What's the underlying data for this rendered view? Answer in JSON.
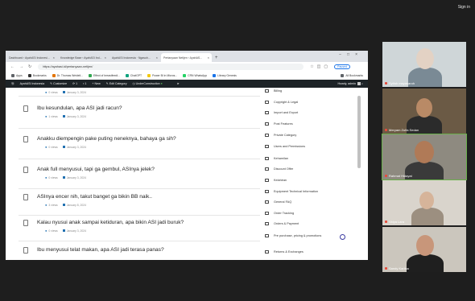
{
  "meeting": {
    "sign_in": "Sign in"
  },
  "browser": {
    "tabs": [
      {
        "label": "Dashboard ‹ AyahASI Indonesi..."
      },
      {
        "label": "Knowledge Base ‹ AyahASI Ind..."
      },
      {
        "label": "AyahASI Indonesia · Ngasuh..."
      },
      {
        "label": "Pertanyaan Netijen ‹ AyahAS..."
      }
    ],
    "url": "https://ayahasi.id/pertanyaan-netijen/",
    "paused_label": "Paused",
    "bookmarks": [
      {
        "label": "Apps",
        "color": "#5f6368"
      },
      {
        "label": "Bookmarks",
        "color": "#333333"
      },
      {
        "label": "Dr. Thomas Weideli...",
        "color": "#e37400"
      },
      {
        "label": "Effect of breastfeedi...",
        "color": "#34a853"
      },
      {
        "label": "ChatGPT",
        "color": "#10a37f"
      },
      {
        "label": "Power BI in Micros...",
        "color": "#f2c811"
      },
      {
        "label": "CRN WhatsApp",
        "color": "#25d366"
      },
      {
        "label": "Library Genesis",
        "color": "#1a73e8"
      }
    ],
    "all_bookmarks": "All Bookmarks"
  },
  "wp_admin": {
    "site": "AyahASI Indonesia",
    "customize": "Customize",
    "updates": "1",
    "comments": "1",
    "new": "+ New",
    "edit_category": "Edit Category",
    "under_construction": "UnderConstruction",
    "howdy": "Howdy, admin"
  },
  "posts": [
    {
      "title": "",
      "views": "0 views",
      "date": "January 3, 2024"
    },
    {
      "title": "Ibu kesundulan, apa ASI jadi racun?",
      "views": "1 views",
      "date": "January 3, 2024"
    },
    {
      "title": "Anakku diempengin pake puting neneknya, bahaya ga sih?",
      "views": "0 views",
      "date": "January 3, 2024"
    },
    {
      "title": "Anak full menyusui, tapi ga gembul, ASInya jelek?",
      "views": "0 views",
      "date": "January 3, 2024"
    },
    {
      "title": "ASInya encer nih, takut banget ga bikin BB naik..",
      "views": "3 views",
      "date": "January 8, 2024"
    },
    {
      "title": "Kalau nyusui anak sampai ketiduran, apa bikin ASI jadi buruk?",
      "views": "0 views",
      "date": "January 3, 2024"
    },
    {
      "title": "Ibu menyusui telat makan, apa ASI jadi terasa panas?",
      "views": "",
      "date": ""
    }
  ],
  "categories": [
    "Billing",
    "Copyright & Legal",
    "Import and Export",
    "Post Features",
    "Private Category",
    "Users and Permissions",
    "Kehamilan",
    "Discount Offer",
    "Kelahiran",
    "Equipment Technical Information",
    "General FAQ",
    "Order Tracking",
    "Orders & Payment",
    "Pre purchase, pricing & promotions",
    "Returns & Exchanges"
  ],
  "participants": [
    {
      "name": "Syifah mayasaroh",
      "bg": "#cfd6d8",
      "skin": "#e3d2c4",
      "top": "#7a8a95"
    },
    {
      "name": "Meryam Zulfa Sedan",
      "bg": "#6b5a45",
      "skin": "#b98a66",
      "top": "#2b2b2b"
    },
    {
      "name": "Rahmat Hidayat",
      "bg": "#8e8a80",
      "skin": "#b07a57",
      "top": "#3a3a3a"
    },
    {
      "name": "Vidya Lara",
      "bg": "#d9d4cc",
      "skin": "#d6b49a",
      "top": "#9c8f80"
    },
    {
      "name": "Sandy Karlina",
      "bg": "#cbc6bd",
      "skin": "#c8967a",
      "top": "#1f1f1f"
    }
  ]
}
